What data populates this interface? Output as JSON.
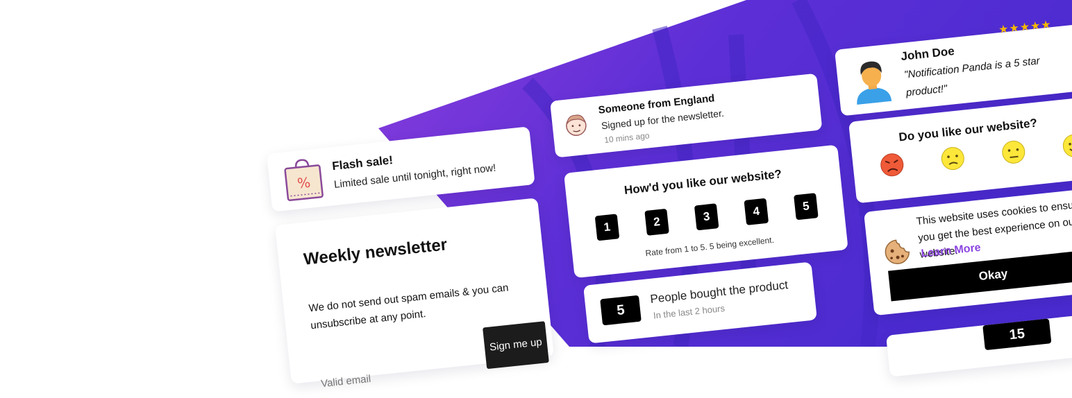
{
  "flash_sale": {
    "title": "Flash sale!",
    "text": "Limited sale until tonight, right now!",
    "icon": "shopping-bag-percent-icon"
  },
  "newsletter": {
    "title": "Weekly newsletter",
    "text": "We do not send out spam emails & you can unsubscribe at any point.",
    "button": "Sign me up",
    "email_placeholder": "Valid email"
  },
  "signup": {
    "title": "Someone from England",
    "text": "Signed up for the newsletter.",
    "time": "10 mins ago",
    "icon": "face-avatar-icon"
  },
  "rating": {
    "title": "How'd you like our website?",
    "options": [
      "1",
      "2",
      "3",
      "4",
      "5"
    ],
    "hint": "Rate from 1 to 5. 5 being excellent."
  },
  "purchases": {
    "count": "5",
    "text": "People bought the product",
    "sub": "In the last 2 hours"
  },
  "review": {
    "name": "John Doe",
    "stars": "★★★★★",
    "rating": 5,
    "quote": "\"Notification Panda is a 5 star product!\"",
    "icon": "user-avatar-icon"
  },
  "emoji_poll": {
    "title": "Do you like our website?",
    "icons": [
      "angry-face-icon",
      "sad-face-icon",
      "neutral-face-icon",
      "happy-face-icon"
    ]
  },
  "cookie": {
    "text": "This website uses cookies to ensure you get the best experience on our website.",
    "link": "Learn More",
    "button": "Okay",
    "icon": "cookie-icon"
  },
  "partial": {
    "value": "15"
  },
  "colors": {
    "brand_purple": "#6a2bd9",
    "accent_purple": "#8c45e0",
    "star_yellow": "#f5b800"
  }
}
